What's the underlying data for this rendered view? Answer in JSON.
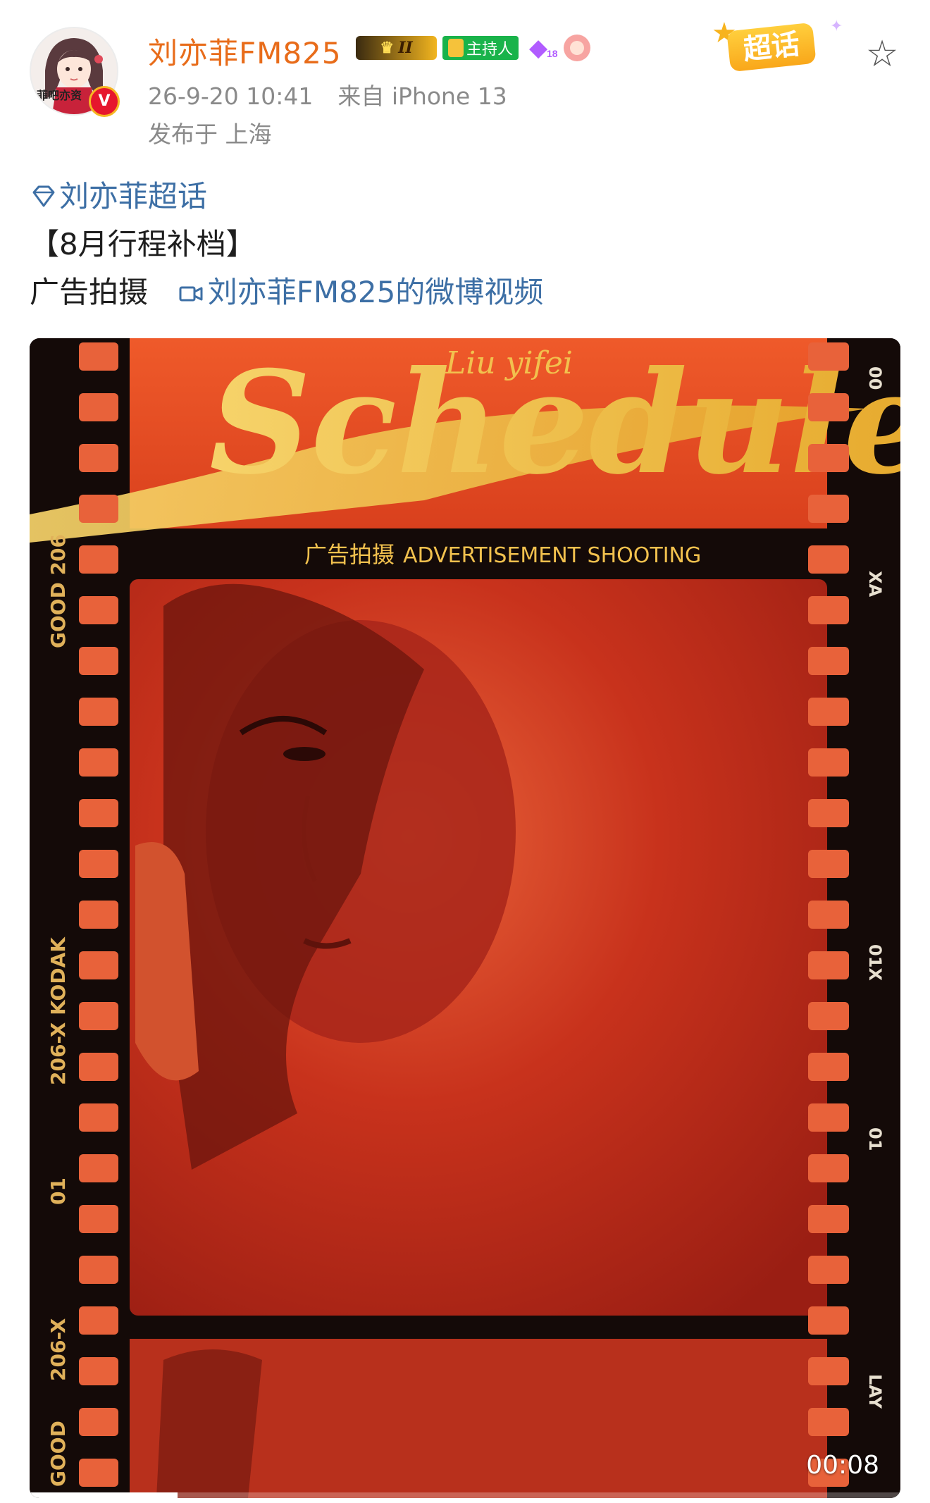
{
  "post": {
    "author": {
      "name": "刘亦菲FM825",
      "avatar_caption": "菲吧亦资",
      "verified_mark": "V",
      "vip_level": "II",
      "host_badge": "主持人",
      "level_badge": "18"
    },
    "meta": {
      "timestamp": "26-9-20 10:41",
      "source": "来自 iPhone 13",
      "location": "发布于 上海"
    },
    "supertopic_button": "超话",
    "content": {
      "topic_link": "刘亦菲超话",
      "line2": "【8月行程补档】",
      "line3_prefix": "广告拍摄",
      "video_link": "刘亦菲FM825的微博视频"
    }
  },
  "video": {
    "overlay": {
      "script_small": "Liu yifei",
      "script_title": "Schedule",
      "subtitle_cn": "广告拍摄",
      "subtitle_en": "ADVERTISEMENT SHOOTING"
    },
    "film_left": [
      "GOOD 206",
      "206-X KODAK",
      "01",
      "206-X",
      "GOOD"
    ],
    "film_right": [
      "00",
      "XA",
      "01X",
      "01",
      "LAY"
    ],
    "duration": "00:08",
    "progress": 0.17
  },
  "colors": {
    "username": "#e86c1a",
    "link": "#3d6fa5",
    "meta": "#8a8a8a",
    "poster_red": "#c9321f",
    "title_gold": "#f2c14e"
  }
}
